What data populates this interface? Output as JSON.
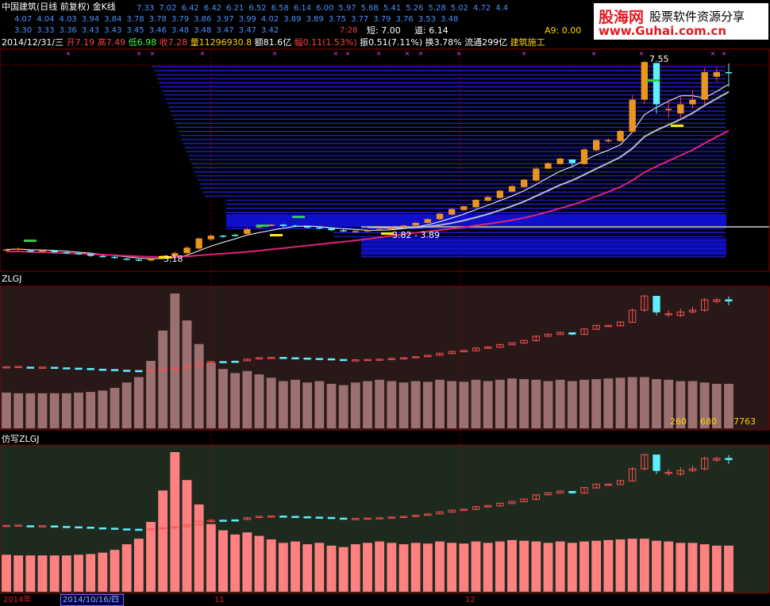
{
  "header": {
    "title": "中国建筑(日线 前复权) 金K线",
    "ma_row1": [
      "7.33",
      "7.02",
      "6.42",
      "6.42",
      "6.21",
      "6.52",
      "6.58",
      "6.14",
      "6.00",
      "5.97",
      "5.68",
      "5.41",
      "5.26",
      "5.28",
      "5.02",
      "4.72",
      "4.4"
    ],
    "ma_row2": [
      "4.07",
      "4.04",
      "4.03",
      "3.94",
      "3.84",
      "3.78",
      "3.78",
      "3.79",
      "3.86",
      "3.97",
      "3.99",
      "4.02",
      "3.89",
      "3.89",
      "3.75",
      "3.77",
      "3.79",
      "3.76",
      "3.53",
      "3.48"
    ],
    "ma_row3": [
      "3.30",
      "3.33",
      "3.36",
      "3.43",
      "3.43",
      "3.45",
      "3.46",
      "3.48",
      "3.48",
      "3.47",
      "3.47",
      "3.42"
    ],
    "last_price": "7:28",
    "short_label": "短: 7.00",
    "dao_label": "道: 6.14",
    "a9_label": "A9: 0.00",
    "info": {
      "date": "2014/12/31/三",
      "open": "开7.19",
      "high": "高7.49",
      "low": "低6.98",
      "close": "收7.28",
      "volume": "量11296930.8",
      "amount": "额81.6亿",
      "change": "幅0.11(1.53%)",
      "amplitude": "振0.51(7.11%)",
      "turnover": "换3.78%",
      "float": "流通299亿",
      "sector": "建筑施工"
    }
  },
  "logo": {
    "brand": "股海网",
    "slogan": "股票软件资源分享",
    "url": "www.Guhai.com.cn"
  },
  "main_chart": {
    "high_label": "7.55",
    "low_label": "3.18",
    "range_label": "3.82 - 3.89"
  },
  "panel2": {
    "title": "ZLGJ",
    "values": [
      "260",
      "680",
      "7763"
    ]
  },
  "panel3": {
    "title": "仿写ZLGJ"
  },
  "date_axis": {
    "year": "2014年",
    "selected": "2014/10/16/四",
    "m11": "11",
    "m12": "12"
  },
  "colors": {
    "up": "#ff5050",
    "down": "#5ff0ff",
    "candle_orange": "#e8961e",
    "ma_white": "#ffffff",
    "ma_magenta": "#e0207a",
    "ma_grey": "#b9b9d0",
    "blue_band": "#2222ee"
  },
  "chart_data": {
    "type": "candlestick",
    "x": [
      "c1",
      "c2",
      "c3",
      "c4",
      "c5",
      "c6",
      "c7",
      "c8",
      "c9",
      "c10",
      "c11",
      "c12",
      "c13",
      "c14",
      "c15",
      "c16",
      "c17",
      "c18",
      "c19",
      "c20",
      "c21",
      "c22",
      "c23",
      "c24",
      "c25",
      "c26",
      "c27",
      "c28",
      "c29",
      "c30",
      "c31",
      "c32",
      "c33",
      "c34",
      "c35",
      "c36",
      "c37",
      "c38",
      "c39",
      "c40",
      "c41",
      "c42",
      "c43",
      "c44",
      "c45",
      "c46",
      "c47",
      "c48",
      "c49",
      "c50",
      "c51",
      "c52",
      "c53",
      "c54",
      "c55",
      "c56",
      "c57",
      "c58",
      "c59",
      "c60",
      "c61"
    ],
    "open": [
      3.42,
      3.44,
      3.42,
      3.4,
      3.41,
      3.38,
      3.36,
      3.34,
      3.3,
      3.28,
      3.24,
      3.22,
      3.2,
      3.24,
      3.3,
      3.36,
      3.46,
      3.66,
      3.74,
      3.76,
      3.78,
      3.92,
      3.96,
      3.98,
      3.96,
      3.94,
      3.92,
      3.9,
      3.86,
      3.84,
      3.84,
      3.86,
      3.88,
      3.92,
      3.96,
      4.02,
      4.1,
      4.2,
      4.3,
      4.36,
      4.5,
      4.56,
      4.7,
      4.8,
      4.94,
      5.2,
      5.3,
      5.4,
      5.3,
      5.6,
      5.8,
      5.8,
      6.0,
      6.7,
      7.5,
      6.5,
      6.4,
      6.6,
      6.7,
      7.2,
      7.3
    ],
    "close": [
      3.44,
      3.46,
      3.4,
      3.42,
      3.38,
      3.36,
      3.34,
      3.3,
      3.28,
      3.26,
      3.22,
      3.2,
      3.24,
      3.3,
      3.36,
      3.48,
      3.68,
      3.74,
      3.72,
      3.74,
      3.88,
      3.96,
      3.98,
      3.95,
      3.94,
      3.92,
      3.9,
      3.86,
      3.84,
      3.84,
      3.86,
      3.88,
      3.92,
      3.96,
      4.02,
      4.1,
      4.22,
      4.32,
      4.38,
      4.52,
      4.58,
      4.72,
      4.82,
      4.96,
      5.2,
      5.32,
      5.42,
      5.32,
      5.62,
      5.82,
      5.82,
      6.02,
      6.7,
      7.52,
      6.6,
      6.5,
      6.6,
      6.7,
      7.3,
      7.3,
      7.28
    ],
    "high": [
      3.46,
      3.48,
      3.44,
      3.44,
      3.42,
      3.4,
      3.38,
      3.36,
      3.32,
      3.3,
      3.26,
      3.24,
      3.26,
      3.32,
      3.4,
      3.52,
      3.7,
      3.78,
      3.76,
      3.78,
      3.92,
      3.98,
      4.0,
      4.0,
      3.98,
      3.96,
      3.94,
      3.92,
      3.88,
      3.86,
      3.88,
      3.9,
      3.94,
      3.98,
      4.04,
      4.12,
      4.24,
      4.34,
      4.4,
      4.54,
      4.62,
      4.74,
      4.84,
      4.98,
      5.24,
      5.34,
      5.44,
      5.4,
      5.64,
      5.84,
      5.86,
      6.04,
      6.8,
      7.55,
      7.0,
      6.7,
      6.8,
      6.9,
      7.4,
      7.4,
      7.49
    ],
    "low": [
      3.4,
      3.42,
      3.38,
      3.38,
      3.36,
      3.34,
      3.32,
      3.28,
      3.26,
      3.24,
      3.2,
      3.18,
      3.18,
      3.22,
      3.28,
      3.34,
      3.44,
      3.62,
      3.7,
      3.72,
      3.76,
      3.9,
      3.94,
      3.92,
      3.92,
      3.9,
      3.88,
      3.84,
      3.82,
      3.82,
      3.82,
      3.84,
      3.86,
      3.9,
      3.94,
      4.0,
      4.08,
      4.18,
      4.28,
      4.34,
      4.48,
      4.54,
      4.68,
      4.78,
      4.9,
      5.18,
      5.28,
      5.26,
      5.28,
      5.58,
      5.76,
      5.78,
      5.98,
      6.6,
      6.4,
      6.3,
      6.3,
      6.5,
      6.6,
      7.1,
      6.98
    ],
    "volume": [
      530,
      520,
      520,
      520,
      520,
      520,
      530,
      540,
      560,
      600,
      680,
      760,
      1000,
      1450,
      2000,
      1600,
      1250,
      970,
      880,
      820,
      850,
      800,
      750,
      700,
      720,
      680,
      700,
      660,
      640,
      680,
      700,
      720,
      700,
      680,
      700,
      690,
      720,
      700,
      690,
      720,
      700,
      720,
      740,
      730,
      720,
      700,
      720,
      700,
      720,
      730,
      740,
      750,
      760,
      760,
      730,
      720,
      700,
      700,
      680,
      660,
      660
    ],
    "ylim": [
      3.0,
      7.8
    ],
    "vol_lim": [
      0,
      2000
    ]
  }
}
